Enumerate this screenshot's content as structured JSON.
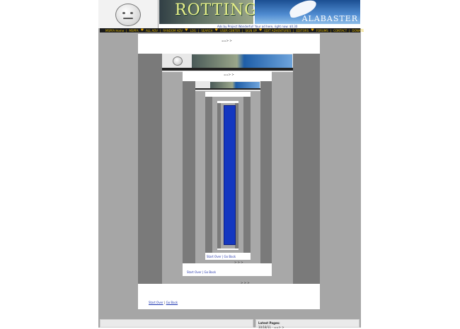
{
  "header": {
    "banner_left_text": "ROTTING",
    "banner_right_text": "ALABASTER",
    "ad_line": "Ads by Project Wonderful! Your ad here, right now: $0.30"
  },
  "nav": {
    "items": [
      "MSPFA Home",
      "MSPFA",
      "ALL ADV",
      "RANDOM ADV",
      "LOG",
      "SEARCH",
      "USER CENTER",
      "SIGN UP",
      "EDIT ADVENTURES",
      "EDITORS",
      "FORUMS",
      "CONTACT",
      "DONATE"
    ]
  },
  "content": {
    "pager": "==> >",
    "nested_caption_1": "> > >",
    "nested_caption_2": "> > >",
    "nested_link_1": "Start Over | Go Back",
    "nested_link_2": "Start Over | Go Back",
    "nested_pager": "==> >"
  },
  "bottom_links": {
    "start_over": "Start Over",
    "separator": "|",
    "go_back": "Go Back"
  },
  "footer": {
    "latest_pages_label": "Latest Pages:",
    "latest_pages_date": "10/18/11 - ==> >"
  },
  "colors": {
    "page_bg": "#a6a6a6",
    "nav_bg": "#1a1a1a",
    "nav_text": "#e0b800",
    "link": "#1a33b0",
    "deep_frame": "#1437c0"
  }
}
